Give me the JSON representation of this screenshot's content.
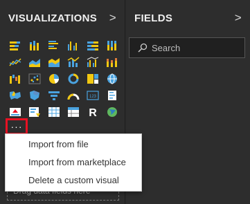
{
  "visualizations": {
    "title": "VISUALIZATIONS",
    "chevron": ">",
    "more_label": "···",
    "icons": [
      "stacked-bar-icon",
      "stacked-column-icon",
      "clustered-bar-icon",
      "clustered-column-icon",
      "100-stacked-bar-icon",
      "100-stacked-column-icon",
      "line-chart-icon",
      "area-chart-icon",
      "stacked-area-icon",
      "line-column-icon",
      "line-clustered-column-icon",
      "ribbon-chart-icon",
      "waterfall-icon",
      "scatter-icon",
      "pie-chart-icon",
      "donut-chart-icon",
      "treemap-icon",
      "globe-map-icon",
      "filled-map-icon",
      "shape-map-icon",
      "funnel-icon",
      "gauge-icon",
      "card-icon",
      "multirow-card-icon",
      "kpi-icon",
      "slicer-icon",
      "table-icon",
      "matrix-icon",
      "r-visual-icon",
      "arcgis-globe-icon"
    ],
    "r_label": "R",
    "card_label": "123",
    "drag_hint": "Drag data fields here"
  },
  "fields": {
    "title": "FIELDS",
    "chevron": ">",
    "search_placeholder": "Search"
  },
  "menu": {
    "items": [
      "Import from file",
      "Import from marketplace",
      "Delete a custom visual"
    ]
  },
  "colors": {
    "highlight": "#e81123",
    "pane": "#2d2d2d",
    "accent_yellow": "#f2c811",
    "accent_blue": "#4aa3df"
  }
}
